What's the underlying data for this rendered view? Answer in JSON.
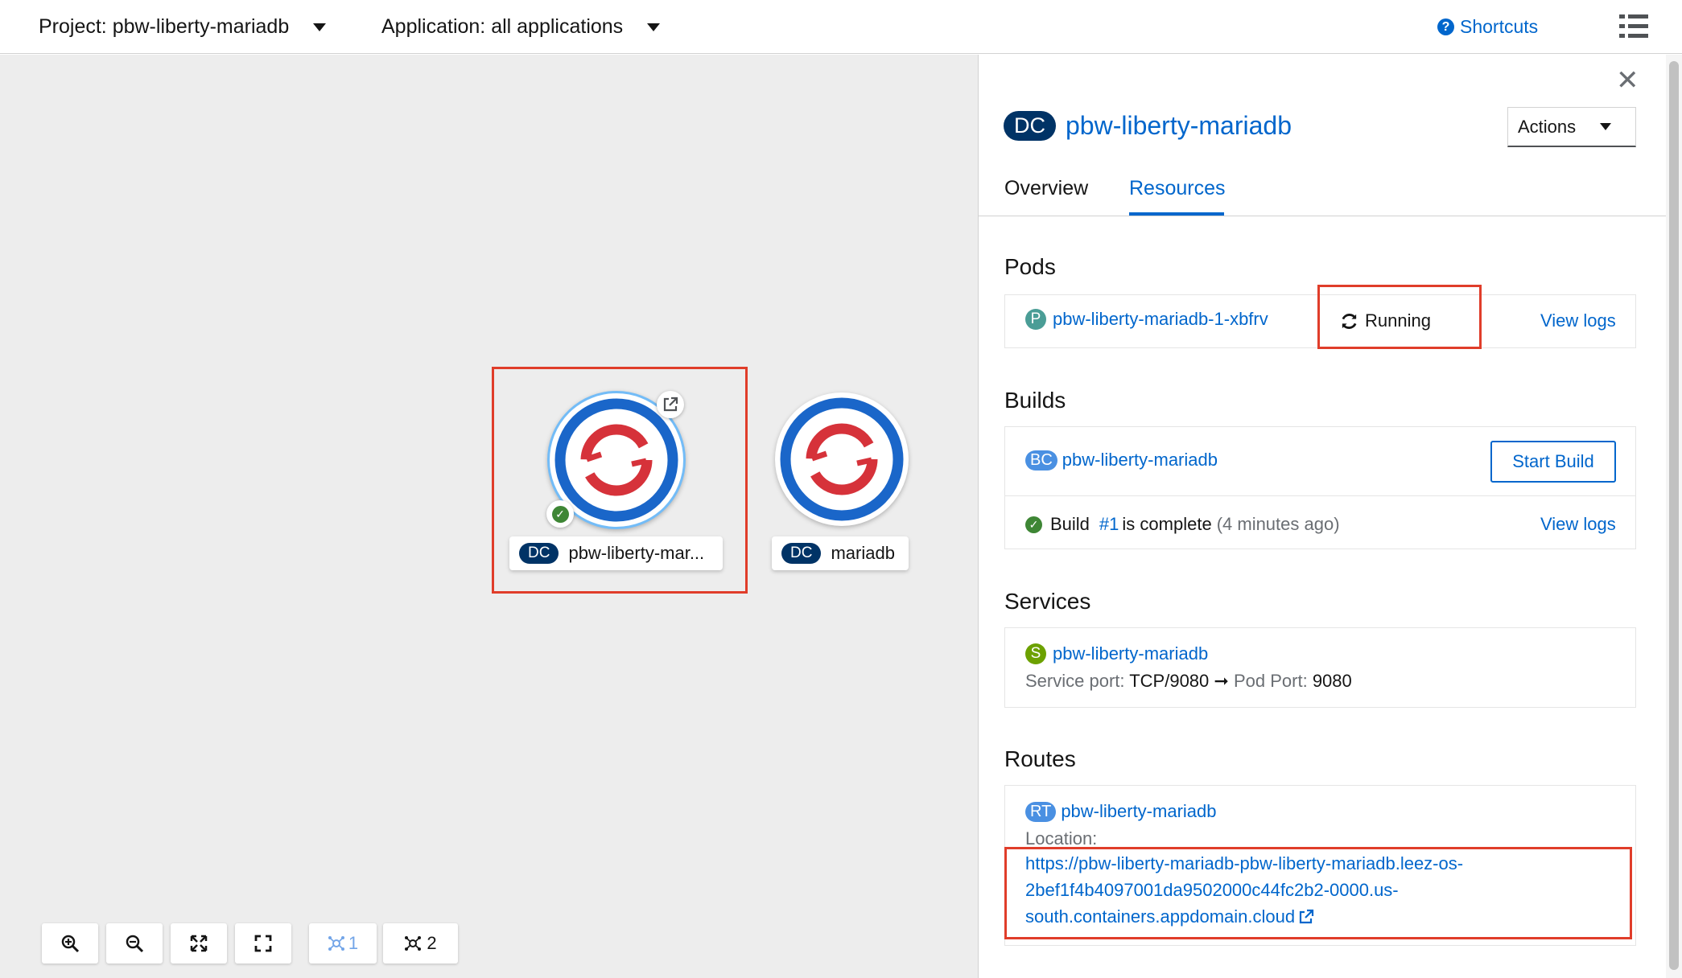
{
  "topbar": {
    "project_label": "Project: pbw-liberty-mariadb",
    "application_label": "Application: all applications",
    "shortcuts_label": "Shortcuts",
    "shortcuts_icon": "question-circle-icon",
    "view_toggle_icon": "list-view-icon"
  },
  "topology": {
    "nodes": [
      {
        "kind": "DC",
        "name": "pbw-liberty-mar...",
        "status": "check-circle-icon",
        "selected": true
      },
      {
        "kind": "DC",
        "name": "mariadb",
        "selected": false
      }
    ],
    "controls": [
      {
        "icon": "zoom-in-icon"
      },
      {
        "icon": "zoom-out-icon"
      },
      {
        "icon": "fit-to-screen-icon"
      },
      {
        "icon": "reset-view-icon"
      },
      {
        "icon": "topology-layout-1-icon",
        "label": "1"
      },
      {
        "icon": "topology-layout-2-icon",
        "label": "2"
      }
    ]
  },
  "panel": {
    "kind_badge": "DC",
    "title": "pbw-liberty-mariadb",
    "actions_label": "Actions",
    "tabs": [
      {
        "label": "Overview",
        "active": false
      },
      {
        "label": "Resources",
        "active": true
      }
    ],
    "pods": {
      "heading": "Pods",
      "badge": "P",
      "name": "pbw-liberty-mariadb-1-xbfrv",
      "status": "Running",
      "view_logs": "View logs"
    },
    "builds": {
      "heading": "Builds",
      "badge": "BC",
      "name": "pbw-liberty-mariadb",
      "start_build": "Start Build",
      "build_prefix": "Build",
      "build_number": "#1",
      "build_status": "is complete",
      "build_time": "(4 minutes ago)",
      "view_logs": "View logs"
    },
    "services": {
      "heading": "Services",
      "badge": "S",
      "name": "pbw-liberty-mariadb",
      "service_port_label": "Service port:",
      "service_port": "TCP/9080",
      "arrow": "➞",
      "pod_port_label": "Pod Port:",
      "pod_port": "9080"
    },
    "routes": {
      "heading": "Routes",
      "badge": "RT",
      "name": "pbw-liberty-mariadb",
      "location_label": "Location:",
      "url_line1": "https://pbw-liberty-mariadb-pbw-liberty-mariadb.leez-os-",
      "url_line2": "2bef1f4b4097001da9502000c44fc2b2-0000.us-",
      "url_line3": "south.containers.appdomain.cloud"
    }
  },
  "colors": {
    "accent": "#0066cc",
    "badge_dark": "#003366",
    "pod_badge": "#4a9d96",
    "build_badge": "#4a90e2",
    "service_badge": "#6ca100",
    "route_badge": "#4a90e2",
    "success": "#3e8635",
    "highlight": "#e03d2a"
  }
}
